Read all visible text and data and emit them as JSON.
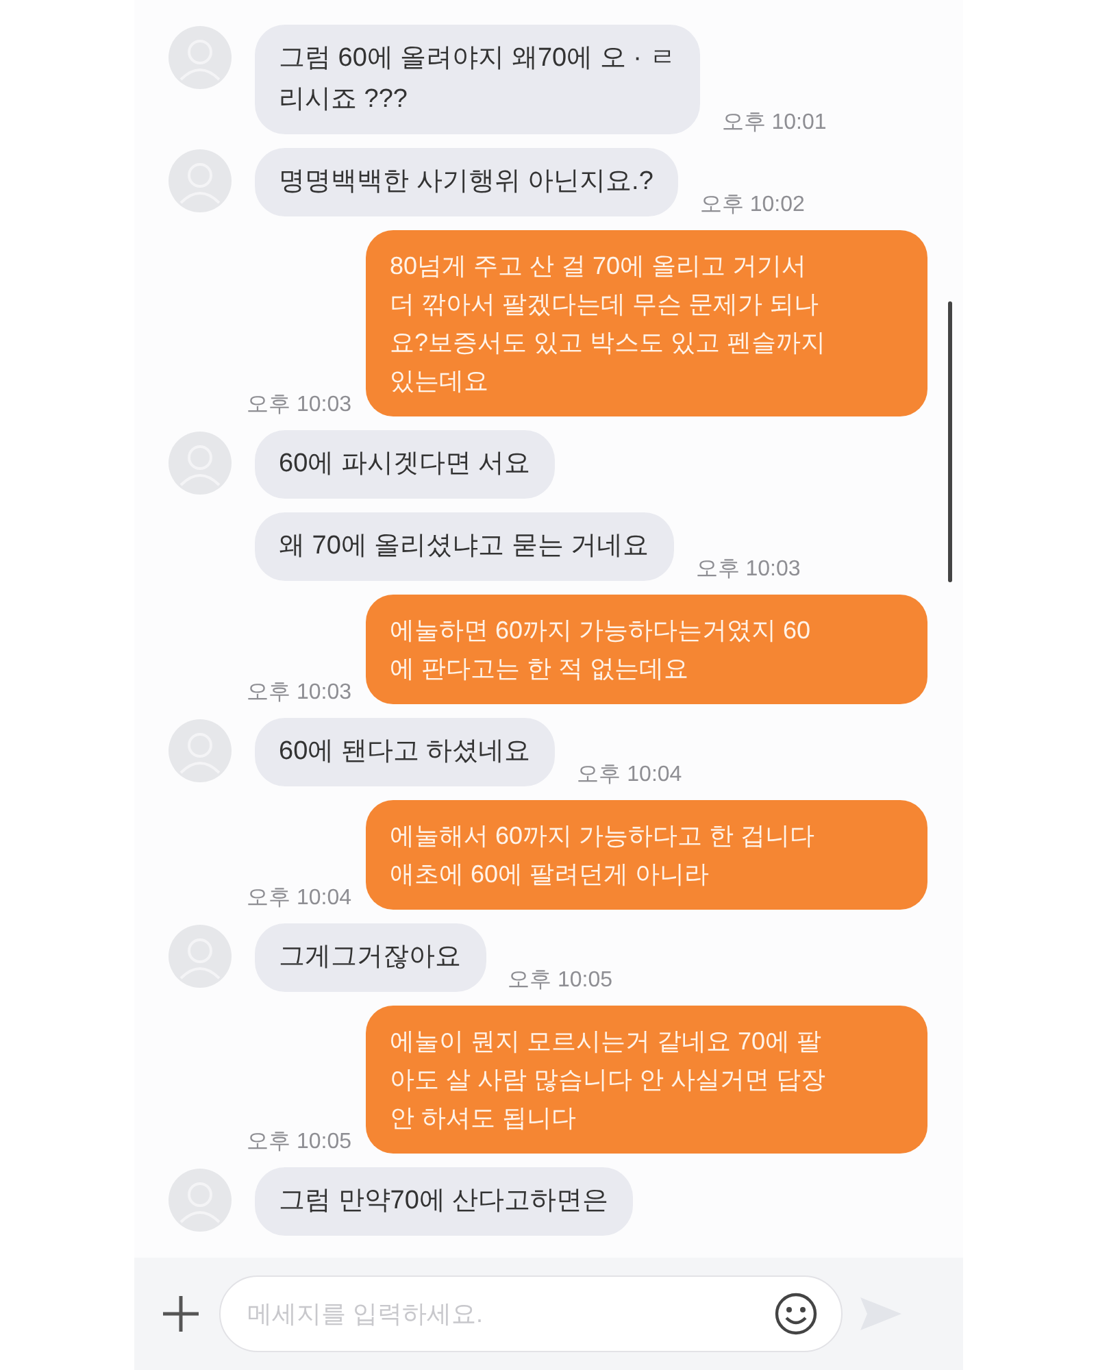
{
  "messages": [
    {
      "kind": "received",
      "avatar": true,
      "lines": [
        "그럼 60에 올려야지 왜70에 오 · ㄹ",
        "리시죠  ???"
      ],
      "time": "오후 10:01"
    },
    {
      "kind": "received",
      "avatar": true,
      "lines": [
        "명명백백한 사기행위 아닌지요.?"
      ],
      "time": "오후 10:02"
    },
    {
      "kind": "sent",
      "lines": [
        "80넘게 주고 산 걸 70에 올리고 거기서",
        "더 깎아서 팔겠다는데 무슨 문제가 되나",
        "요?보증서도 있고 박스도 있고 펜슬까지",
        "있는데요"
      ],
      "time": "오후 10:03"
    },
    {
      "kind": "received",
      "avatar": true,
      "lines": [
        "60에 파시겟다면  서요"
      ]
    },
    {
      "kind": "received",
      "avatar": false,
      "lines": [
        "왜 70에 올리셨냐고 묻는   거네요"
      ],
      "time": "오후 10:03"
    },
    {
      "kind": "sent",
      "lines": [
        "에눌하면 60까지 가능하다는거였지 60",
        "에 판다고는 한 적 없는데요"
      ],
      "time": "오후 10:03"
    },
    {
      "kind": "received",
      "avatar": true,
      "lines": [
        "60에 됀다고 하셨네요"
      ],
      "time": "오후 10:04"
    },
    {
      "kind": "sent",
      "lines": [
        "에눌해서 60까지 가능하다고 한 겁니다",
        "애초에 60에 팔려던게 아니라"
      ],
      "time": "오후 10:04"
    },
    {
      "kind": "received",
      "avatar": true,
      "lines": [
        "그게그거잖아요"
      ],
      "time": "오후 10:05"
    },
    {
      "kind": "sent",
      "lines": [
        "에눌이 뭔지 모르시는거 같네요 70에 팔",
        "아도 살 사람 많습니다 안 사실거면 답장",
        "안 하셔도 됩니다"
      ],
      "time": "오후 10:05"
    },
    {
      "kind": "received",
      "avatar": true,
      "lines": [
        "그럼 만약70에 산다고하면은"
      ]
    }
  ],
  "composer": {
    "placeholder": "메세지를 입력하세요."
  }
}
